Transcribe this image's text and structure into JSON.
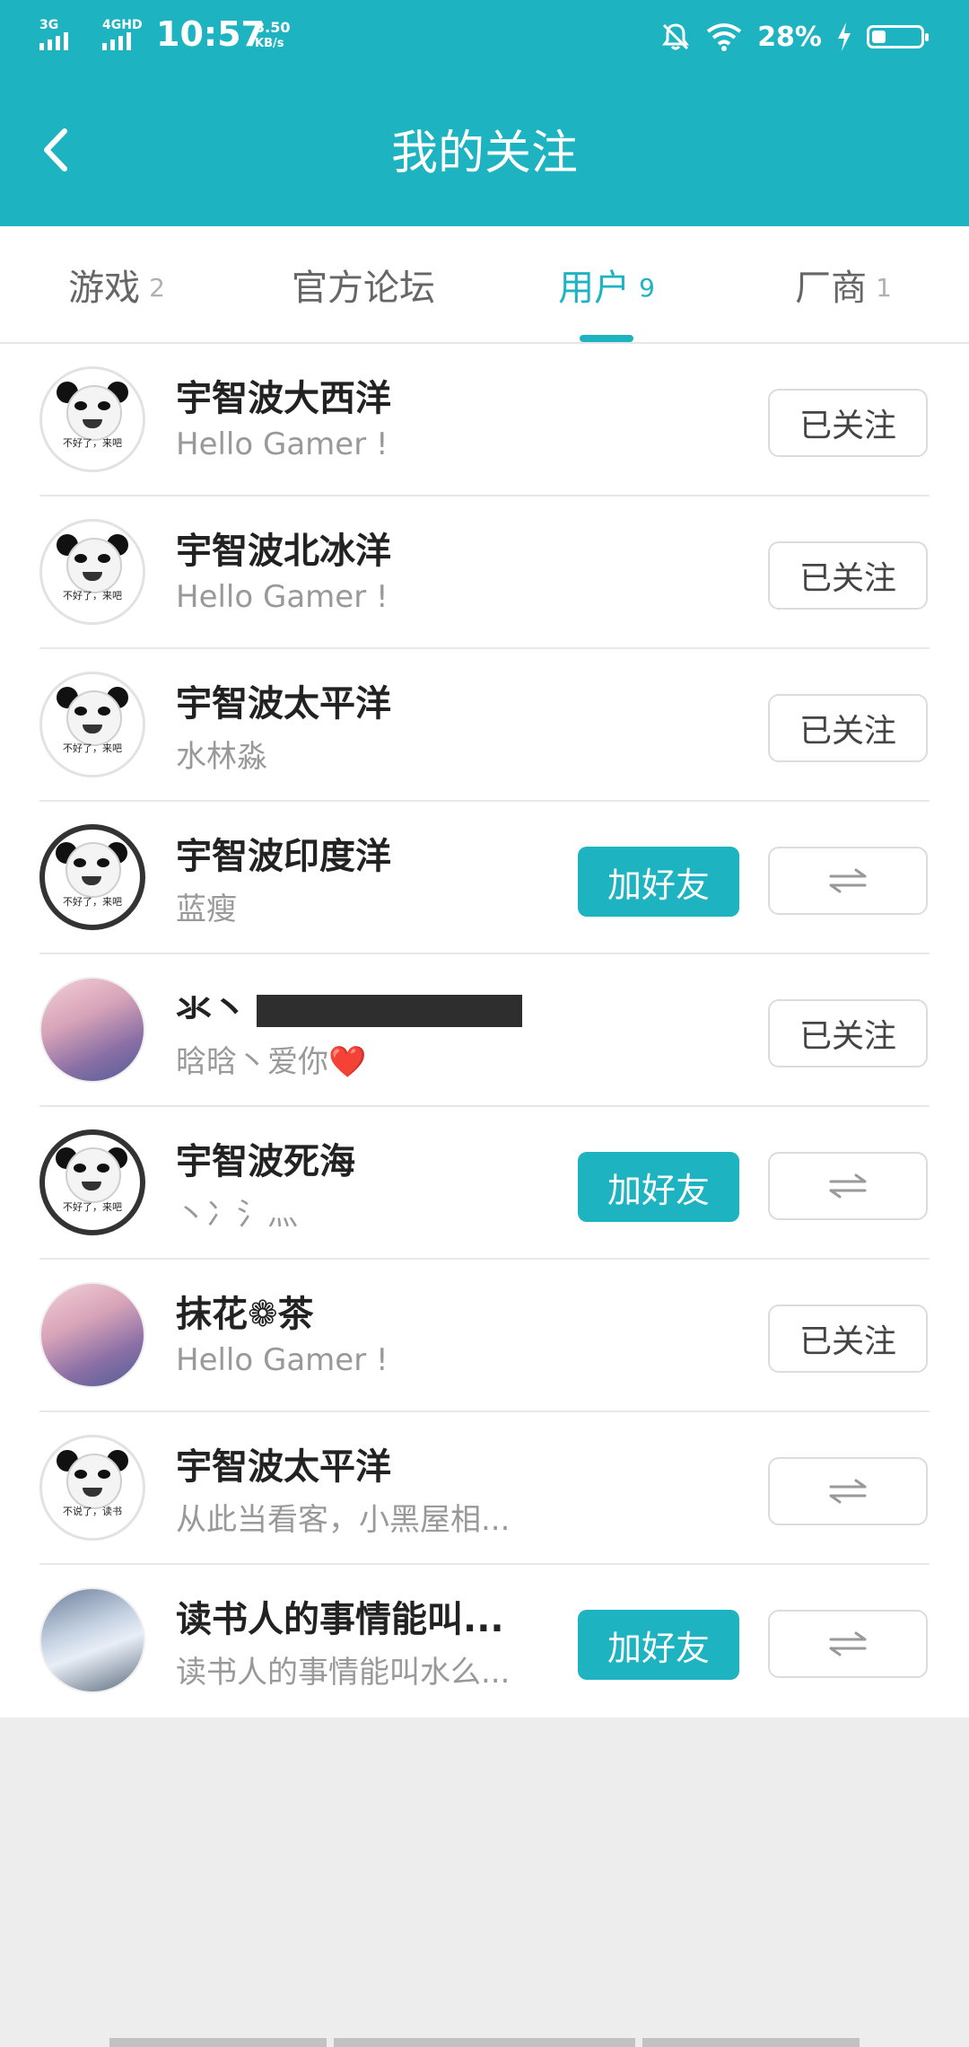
{
  "status_bar": {
    "network_1": "3G",
    "network_2": "4GHD",
    "time": "10:57",
    "speed_value": "3.50",
    "speed_unit": "KB/s",
    "battery_pct": "28%",
    "battery_level": 0.28,
    "icons": [
      "mute-icon",
      "wifi-icon",
      "charging-icon",
      "battery-icon"
    ]
  },
  "header": {
    "title": "我的关注",
    "back_icon": "chevron-left-icon",
    "bg_color": "#1eb3c1"
  },
  "tabs": [
    {
      "label": "游戏",
      "count": "2",
      "active": false
    },
    {
      "label": "官方论坛",
      "count": "",
      "active": false
    },
    {
      "label": "用户",
      "count": "9",
      "active": true
    },
    {
      "label": "厂商",
      "count": "1",
      "active": false
    }
  ],
  "users": [
    {
      "name": "宇智波大西洋",
      "signature": "Hello Gamer !",
      "action": "已关注"
    },
    {
      "name": "宇智波北冰洋",
      "signature": "Hello Gamer !",
      "action": "已关注"
    },
    {
      "name": "宇智波太平洋",
      "signature": "水林淼",
      "action": "已关注"
    },
    {
      "name": "宇智波印度洋",
      "signature": "蓝瘦",
      "add_label": "加好友",
      "mutual_icon": "mutual-follow-icon"
    },
    {
      "name": "氺丶",
      "signature": "晗晗丶爱你❤️",
      "action": "已关注"
    },
    {
      "name": "宇智波死海",
      "signature": "丶冫氵灬",
      "add_label": "加好友",
      "mutual_icon": "mutual-follow-icon"
    },
    {
      "name": "抹花❁茶",
      "signature": "Hello Gamer !",
      "action": "已关注"
    },
    {
      "name": "宇智波太平洋",
      "signature": "从此当看客，小黑屋相...",
      "mutual_icon": "mutual-follow-icon"
    },
    {
      "name": "读书人的事情能叫...",
      "signature": "读书人的事情能叫水么...",
      "add_label": "加好友",
      "mutual_icon": "mutual-follow-icon"
    }
  ],
  "panda_captions": [
    "不好了，来吧",
    "不说了，读书"
  ],
  "colors": {
    "accent": "#1eb3c1",
    "background": "#ededed"
  }
}
